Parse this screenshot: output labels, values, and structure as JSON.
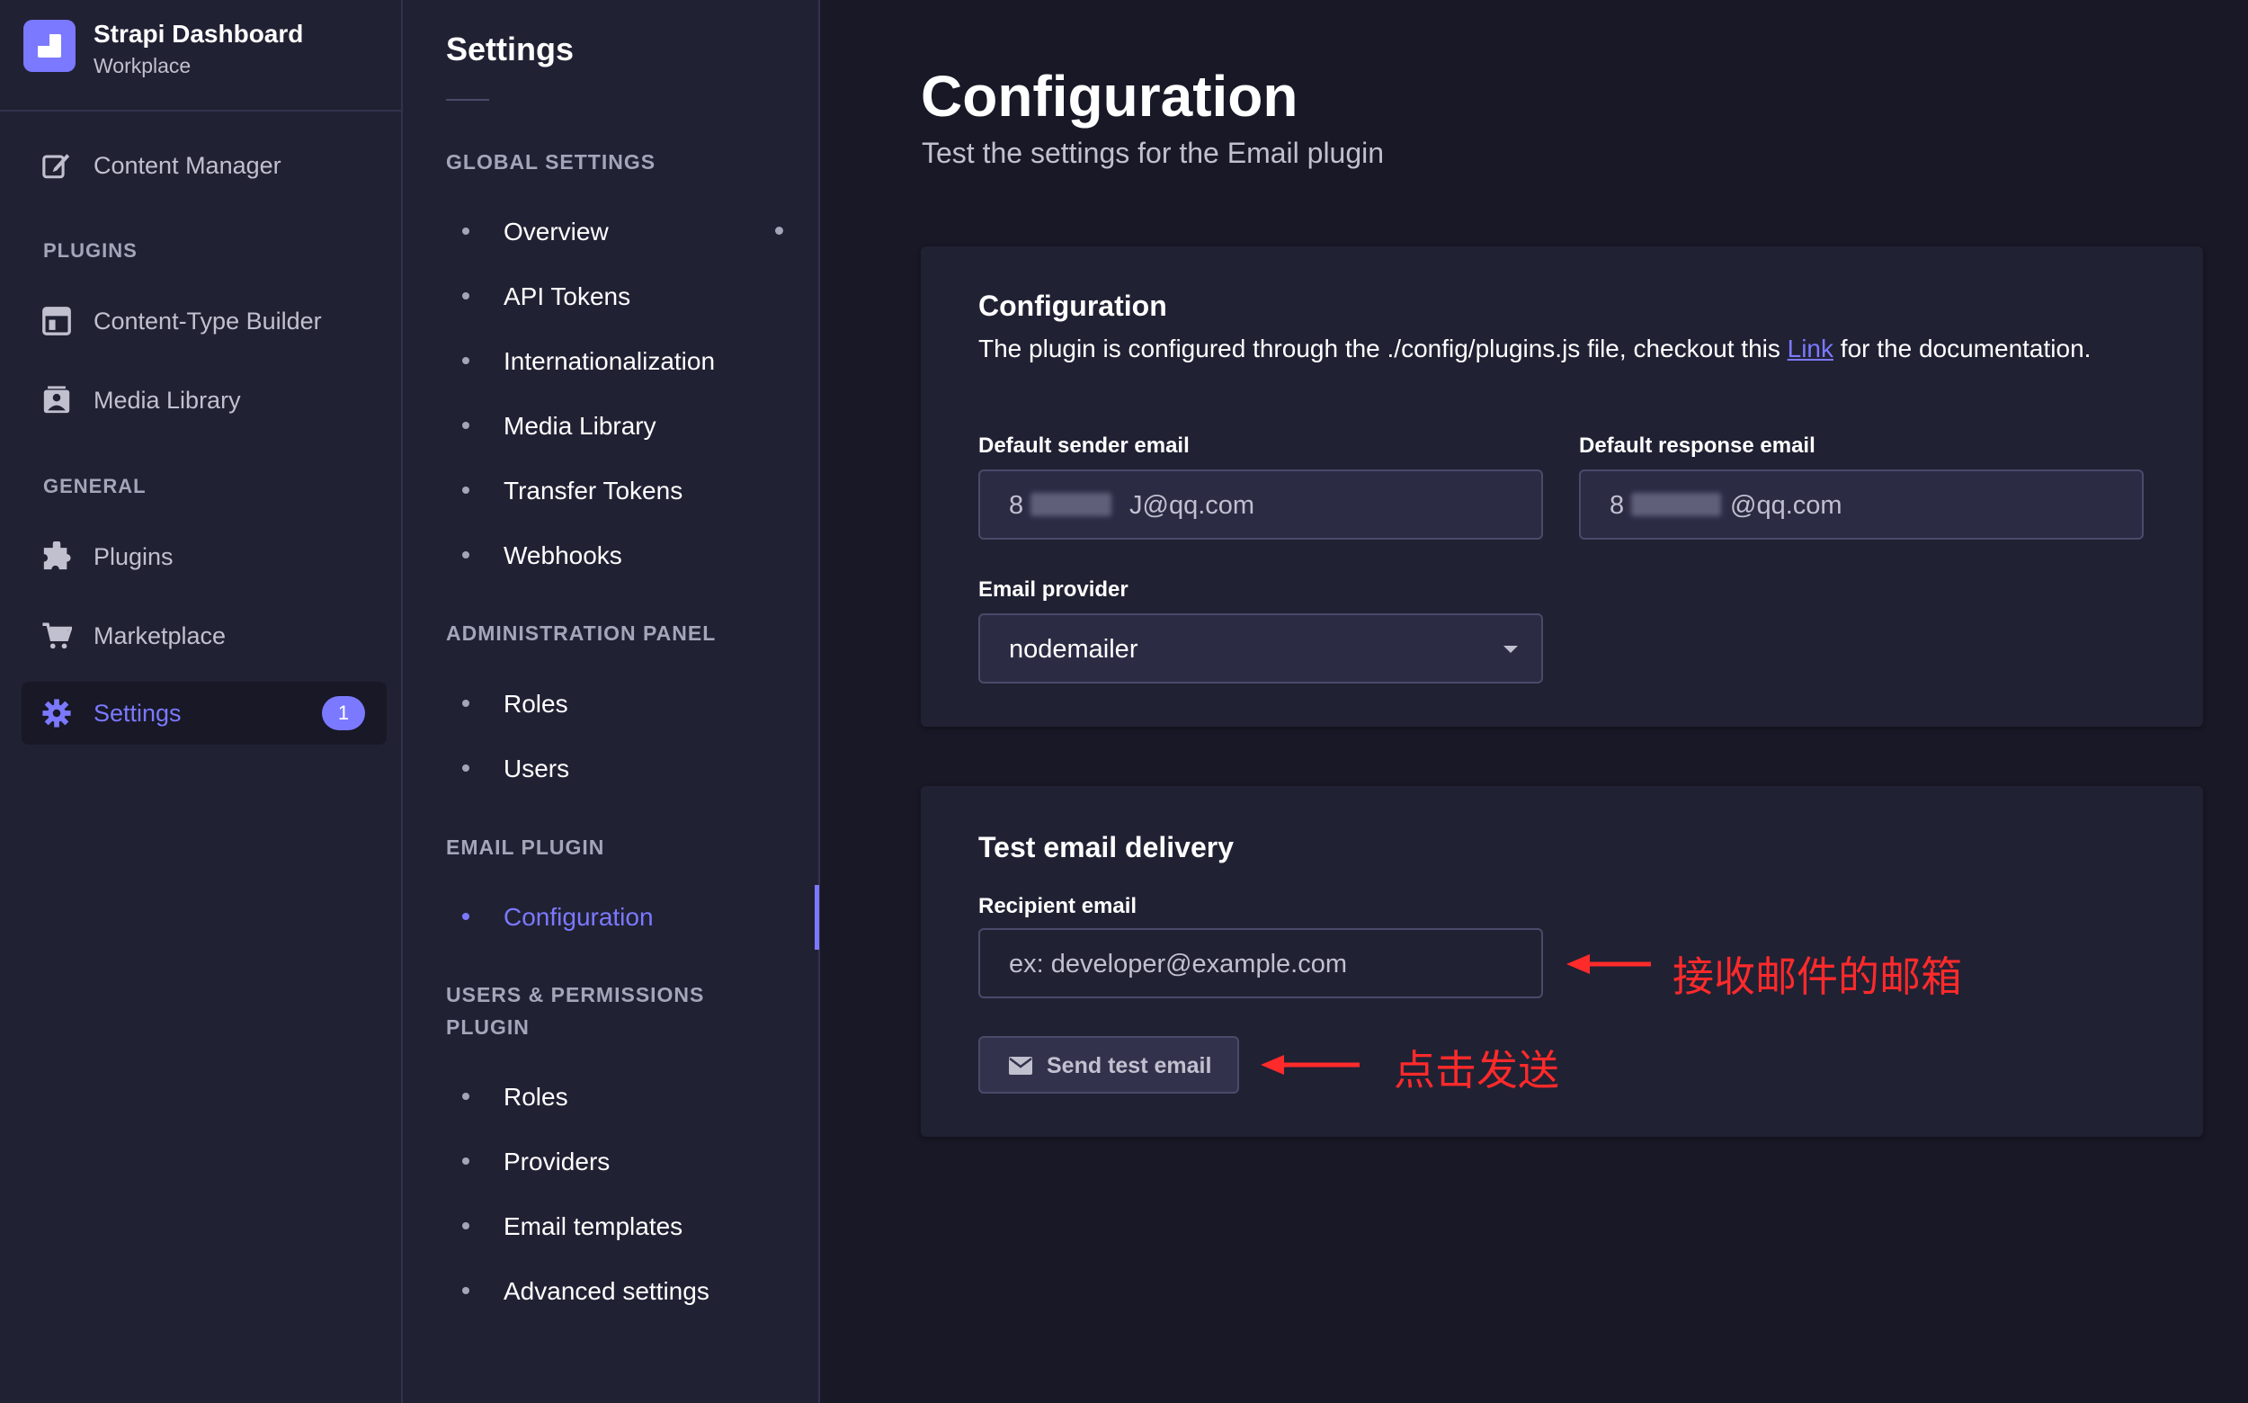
{
  "brand": {
    "title": "Strapi Dashboard",
    "subtitle": "Workplace"
  },
  "sidebar": {
    "content_manager": "Content Manager",
    "plugins_section": "PLUGINS",
    "content_type_builder": "Content-Type Builder",
    "media_library": "Media Library",
    "general_section": "GENERAL",
    "plugins": "Plugins",
    "marketplace": "Marketplace",
    "settings": "Settings",
    "settings_badge": "1"
  },
  "subnav": {
    "title": "Settings",
    "global_section": "GLOBAL SETTINGS",
    "global_items": [
      "Overview",
      "API Tokens",
      "Internationalization",
      "Media Library",
      "Transfer Tokens",
      "Webhooks"
    ],
    "admin_section": "ADMINISTRATION PANEL",
    "admin_items": [
      "Roles",
      "Users"
    ],
    "email_section": "EMAIL PLUGIN",
    "email_items": [
      "Configuration"
    ],
    "up_section": "USERS & PERMISSIONS PLUGIN",
    "up_items": [
      "Roles",
      "Providers",
      "Email templates",
      "Advanced settings"
    ]
  },
  "main": {
    "title": "Configuration",
    "subtitle": "Test the settings for the Email plugin"
  },
  "config_card": {
    "heading": "Configuration",
    "desc_before": "The plugin is configured through the ./config/plugins.js file, checkout this ",
    "desc_link": "Link",
    "desc_after": " for the documentation.",
    "sender_label": "Default sender email",
    "sender_value_prefix": "8",
    "sender_value_suffix": "J@qq.com",
    "response_label": "Default response email",
    "response_value_prefix": "8",
    "response_value_suffix": "@qq.com",
    "provider_label": "Email provider",
    "provider_value": "nodemailer"
  },
  "test_card": {
    "heading": "Test email delivery",
    "recipient_label": "Recipient email",
    "recipient_placeholder": "ex: developer@example.com",
    "send_button": "Send test email"
  },
  "annotations": {
    "recipient_note": "接收邮件的邮箱",
    "send_note": "点击发送",
    "color": "#ff2a2a"
  },
  "colors": {
    "accent": "#7b79ff",
    "background": "#181826",
    "panel": "#212134"
  }
}
